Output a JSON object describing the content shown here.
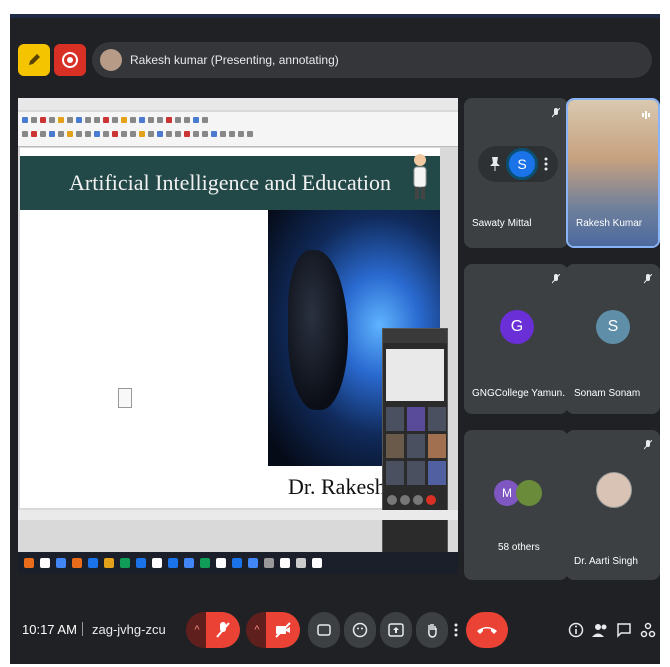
{
  "topbar": {
    "presenter_text": "Rakesh kumar (Presenting, annotating)"
  },
  "slide": {
    "title": "Artificial Intelligence and Education",
    "author": "Dr. Rakesh"
  },
  "participants": [
    {
      "name": "Sawaty Mittal",
      "initial": "S",
      "color": "#1a73e8"
    },
    {
      "name": "Rakesh Kumar"
    },
    {
      "name": "GNGCollege Yamun...",
      "initial": "G",
      "color": "#6a2fd6"
    },
    {
      "name": "Sonam Sonam",
      "initial": "S",
      "color": "#5f8fa8"
    },
    {
      "name": "58 others",
      "initial": "M",
      "color": "#7e57c2"
    },
    {
      "name": "Dr. Aarti Singh"
    }
  ],
  "bottombar": {
    "time": "10:17 AM",
    "meeting_code": "zag-jvhg-zcu"
  },
  "colors": {
    "accent_red": "#ea4335",
    "background": "#202124",
    "tile": "#3c4043"
  }
}
